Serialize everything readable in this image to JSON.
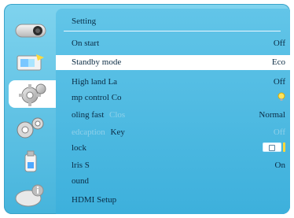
{
  "menu": {
    "title": "Setting",
    "items": [
      {
        "label": "On start",
        "value": "Off",
        "dim_label": ""
      },
      {
        "label": "Standby mode",
        "value": "Eco",
        "dim_label": ""
      },
      {
        "label": "High land  La",
        "value": "Off",
        "dim_label": ""
      },
      {
        "label": "mp control  Co",
        "value": "",
        "dim_label": ""
      },
      {
        "label": "oling fast",
        "dim_label": "Clos",
        "value": "Normal"
      },
      {
        "label": "Key",
        "dim_label": "edcaption",
        "value": "Off"
      },
      {
        "label": "lock",
        "value": "",
        "dim_label": ""
      },
      {
        "label": "lris  S",
        "value": "On",
        "dim_label": ""
      },
      {
        "label": "ound",
        "value": "",
        "dim_label": ""
      },
      {
        "label": "HDMI Setup",
        "value": "",
        "dim_label": ""
      }
    ]
  },
  "rail": {
    "tabs": [
      "display-icon",
      "picture-icon",
      "settings-gear-icon",
      "advanced-gears-icon",
      "usb-memory-icon",
      "info-icon"
    ]
  },
  "colors": {
    "frame_top": "#7fd3ee",
    "frame_bottom": "#46b4dc",
    "panel": "#3db0dc",
    "selected_row": "#ffffff"
  }
}
